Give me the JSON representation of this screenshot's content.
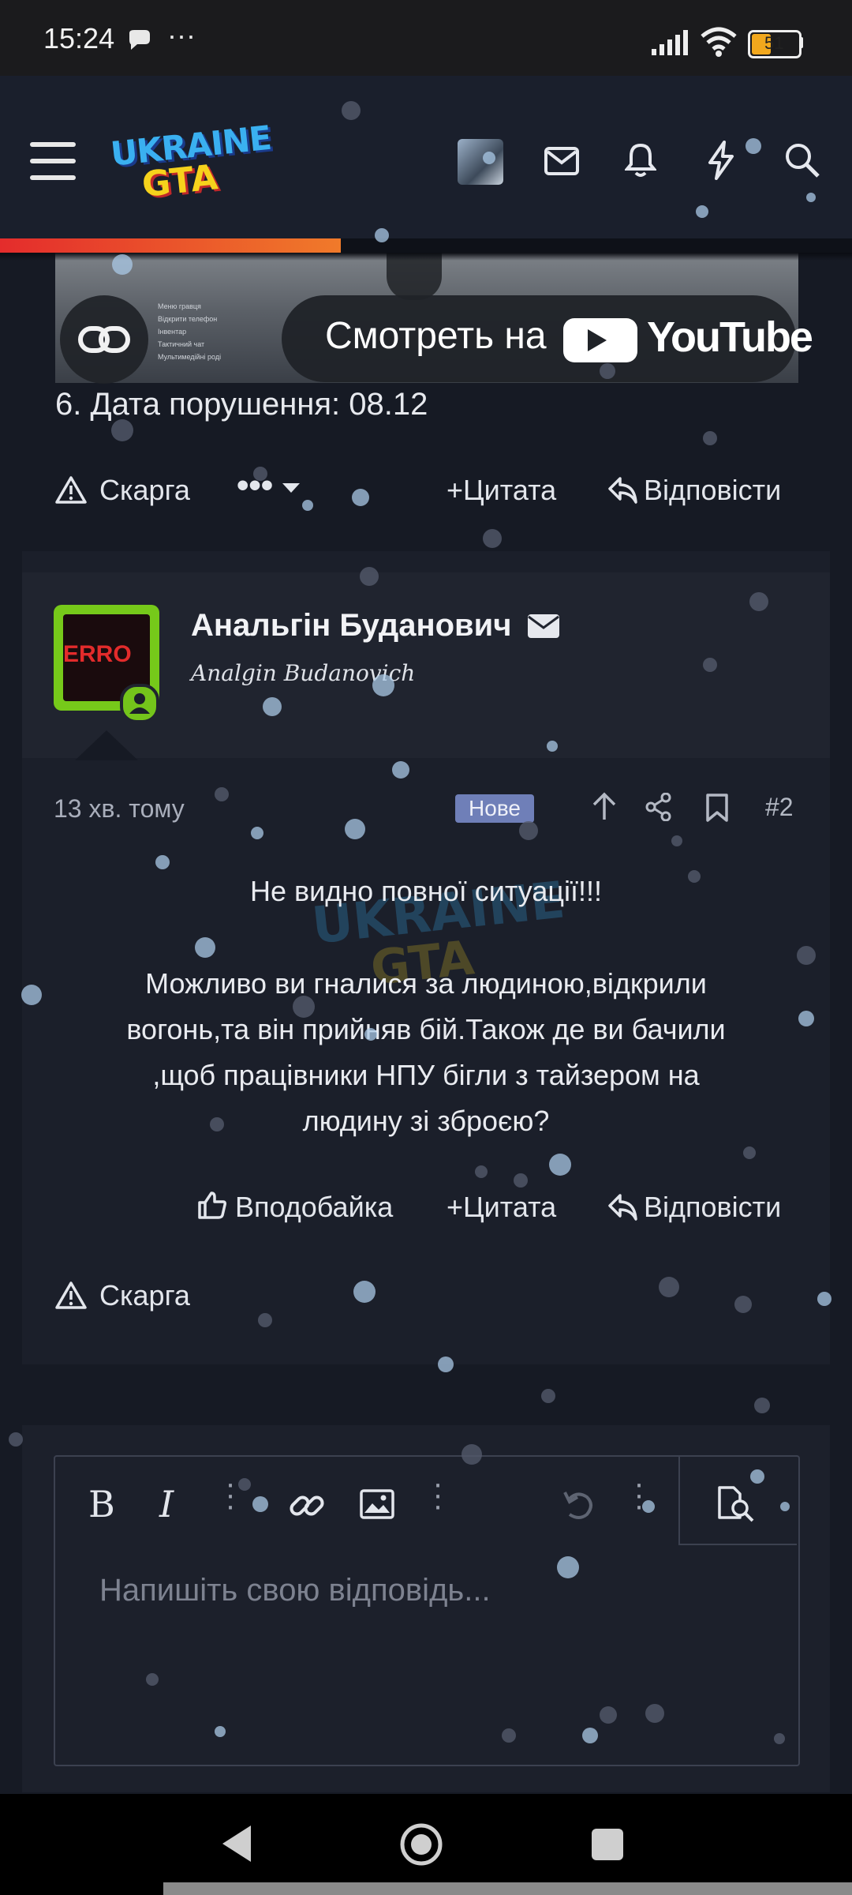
{
  "status_bar": {
    "time": "15:24",
    "battery": "51"
  },
  "header": {
    "logo_text_top": "UKRAINE",
    "logo_text_bottom": "GTA",
    "progress_percent": 40
  },
  "video": {
    "watch_on": "Смотреть на",
    "brand": "YouTube",
    "menu_items": [
      "Меню гравця",
      "Відкрити телефон",
      "Інвентар",
      "Тактичний чат",
      "Мультимедійні роді"
    ]
  },
  "post1": {
    "last_line": "6. Дата порушення: 08.12",
    "report": "Скарга",
    "quote": "Цитата",
    "reply": "Відповісти"
  },
  "post2": {
    "avatar_text": "ERRO",
    "username": "Анальгін Буданович",
    "user_title": "Analgin Budanovich",
    "time": "13 хв. тому",
    "badge": "Нове",
    "number": "#2",
    "text_line1": "Не видно повної ситуації!!!",
    "text_para": [
      "Можливо ви гналися за людиною,відкрили",
      "вогонь,та він прийняв бій.Також де ви бачили",
      ",щоб працівники НПУ бігли з тайзером на",
      "людину зі зброєю?"
    ],
    "like": "Вподобайка",
    "quote": "Цитата",
    "reply": "Відповісти",
    "report": "Скарга"
  },
  "editor": {
    "placeholder": "Напишіть свою відповідь..."
  },
  "colors": {
    "accent_green": "#76c91a",
    "badge": "#6f7fb8",
    "progress": "#e42c2c"
  }
}
